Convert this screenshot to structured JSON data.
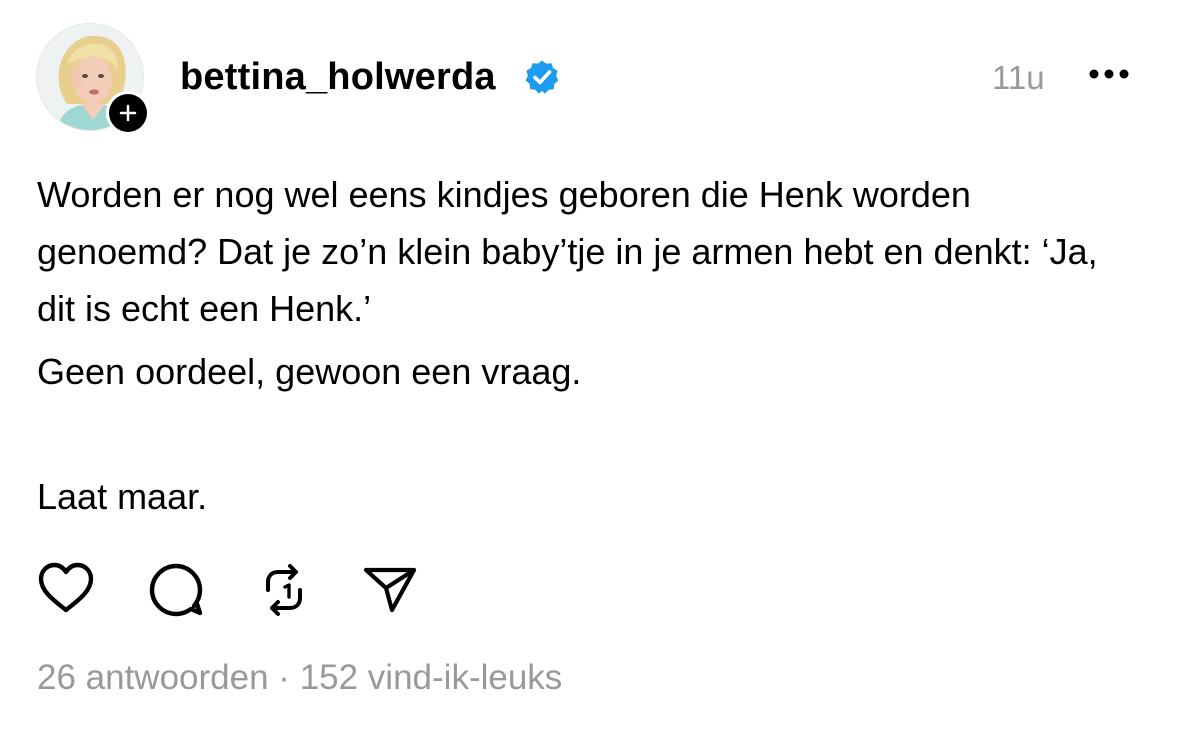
{
  "post": {
    "username": "bettina_holwerda",
    "verified": true,
    "timestamp": "11u",
    "body": [
      "Worden er nog wel eens kindjes geboren die Henk worden genoemd? Dat je zo’n klein baby’tje in je armen hebt en denkt: ‘Ja, dit is echt een Henk.’",
      "Geen oordeel, gewoon een vraag.",
      "Laat maar."
    ]
  },
  "stats": {
    "replies": "26 antwoorden",
    "separator": " · ",
    "likes": "152 vind-ik-leuks"
  },
  "icons": {
    "more": "more-icon",
    "verified": "verified-icon",
    "follow": "plus-icon",
    "like": "heart-icon",
    "reply": "comment-icon",
    "repost": "repost-icon",
    "share": "send-icon"
  },
  "colors": {
    "verified_blue": "#1d9bf0",
    "muted_text": "#999999",
    "text": "#000000"
  }
}
